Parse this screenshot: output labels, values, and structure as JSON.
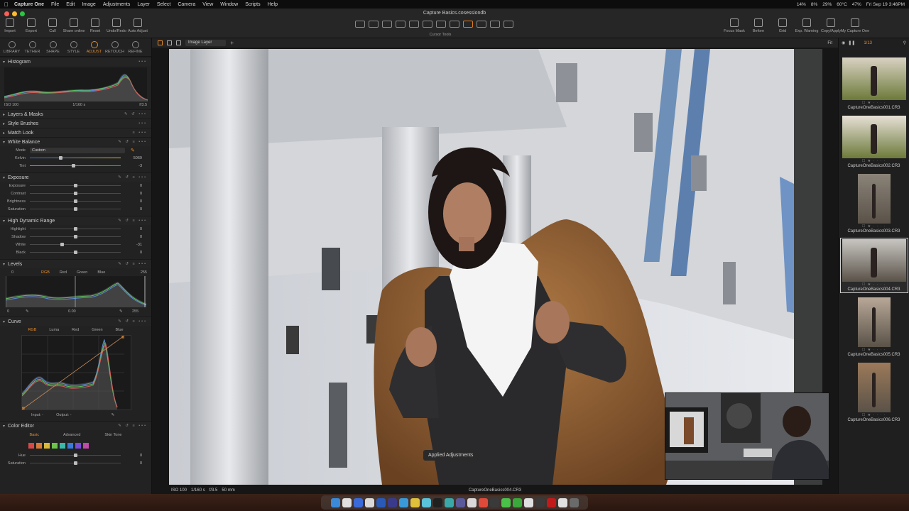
{
  "menubar": {
    "items": [
      "Capture One",
      "File",
      "Edit",
      "Image",
      "Adjustments",
      "Layer",
      "Select",
      "Camera",
      "View",
      "Window",
      "Scripts",
      "Help"
    ],
    "status": [
      "14%",
      "8%",
      "29%",
      "60°C",
      "47%",
      "Fri Sep 19  3:46PM"
    ]
  },
  "window": {
    "title": "Capture Basics.cosessiondb"
  },
  "toolbar": {
    "left": [
      "Import",
      "Export",
      "Cull",
      "Share online",
      "Reset",
      "Undo/Redo",
      "Auto Adjust"
    ],
    "cursor_tools_label": "Cursor Tools",
    "right": [
      "Focus Mask",
      "Before",
      "Grid",
      "Exp. Warning",
      "Copy/Apply",
      "My Capture One"
    ]
  },
  "tool_tabs": [
    {
      "label": "LIBRARY",
      "active": false
    },
    {
      "label": "TETHER",
      "active": false
    },
    {
      "label": "SHAPE",
      "active": false
    },
    {
      "label": "STYLE",
      "active": false
    },
    {
      "label": "ADJUST",
      "active": true
    },
    {
      "label": "RETOUCH",
      "active": false
    },
    {
      "label": "REFINE",
      "active": false
    }
  ],
  "histogram": {
    "title": "Histogram",
    "iso": "ISO 100",
    "shutter": "1/160 s",
    "aperture": "f/3.5"
  },
  "sections": {
    "layers": "Layers & Masks",
    "style_brushes": "Style Brushes",
    "match_look": "Match Look",
    "white_balance": "White Balance",
    "exposure": "Exposure",
    "hdr": "High Dynamic Range",
    "levels": "Levels",
    "curve": "Curve",
    "color_editor": "Color Editor"
  },
  "white_balance": {
    "mode_label": "Mode",
    "mode_value": "Custom",
    "kelvin": {
      "label": "Kelvin",
      "value": "5069",
      "pos": 0.33
    },
    "tint": {
      "label": "Tint",
      "value": "-3",
      "pos": 0.48
    }
  },
  "exposure": [
    {
      "label": "Exposure",
      "value": "0",
      "pos": 0.5
    },
    {
      "label": "Contrast",
      "value": "0",
      "pos": 0.5
    },
    {
      "label": "Brightness",
      "value": "0",
      "pos": 0.5
    },
    {
      "label": "Saturation",
      "value": "0",
      "pos": 0.5
    }
  ],
  "hdr": [
    {
      "label": "Highlight",
      "value": "0",
      "pos": 0.5
    },
    {
      "label": "Shadow",
      "value": "0",
      "pos": 0.5
    },
    {
      "label": "White",
      "value": "-31",
      "pos": 0.35
    },
    {
      "label": "Black",
      "value": "0",
      "pos": 0.5
    }
  ],
  "levels": {
    "channels": [
      "RGB",
      "Red",
      "Green",
      "Blue"
    ],
    "input_low": "0",
    "input_high": "255",
    "output_low": "0",
    "output_mid": "0.00",
    "output_high": "255"
  },
  "curve": {
    "channels": [
      "RGB",
      "Luma",
      "Red",
      "Green",
      "Blue"
    ],
    "input_label": "Input:",
    "input_value": "-",
    "output_label": "Output:",
    "output_value": "-"
  },
  "color_editor": {
    "tabs": [
      "Basic",
      "Advanced",
      "Skin Tone"
    ],
    "swatches": [
      "#d94848",
      "#d97a3a",
      "#d9b83a",
      "#6cc24a",
      "#3ab8a8",
      "#3a7ad9",
      "#7a4ad9",
      "#c24aa8"
    ],
    "rows": [
      {
        "label": "Hue",
        "value": "0",
        "pos": 0.5
      },
      {
        "label": "Saturation",
        "value": "0",
        "pos": 0.5
      }
    ]
  },
  "viewer": {
    "layer_select": "Image Layer",
    "fit_label": "Fit",
    "info": [
      "ISO 100",
      "1/160 s",
      "f/3.5",
      "50 mm"
    ],
    "filename": "CaptureOneBasics004.CR3",
    "toast": "Applied Adjustments"
  },
  "browser": {
    "count": "1/13",
    "thumbs": [
      {
        "name": "CaptureOneBasics001.CR3",
        "portrait": false,
        "selected": false
      },
      {
        "name": "CaptureOneBasics002.CR3",
        "portrait": false,
        "selected": false
      },
      {
        "name": "CaptureOneBasics003.CR3",
        "portrait": true,
        "selected": false
      },
      {
        "name": "CaptureOneBasics004.CR3",
        "portrait": false,
        "selected": true
      },
      {
        "name": "CaptureOneBasics005.CR3",
        "portrait": true,
        "selected": false
      },
      {
        "name": "CaptureOneBasics006.CR3",
        "portrait": true,
        "selected": false
      }
    ]
  },
  "colors": {
    "accent": "#e58a2b",
    "panel": "#222222",
    "viewer_bg": "#161616"
  }
}
